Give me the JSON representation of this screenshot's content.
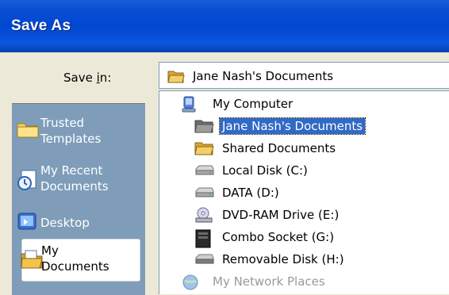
{
  "window": {
    "title": "Save As"
  },
  "save_in": {
    "label": "Save in:",
    "value": "Jane Nash's Documents"
  },
  "places_bar": {
    "items": [
      {
        "label_line1": "Trusted",
        "label_line2": "Templates",
        "icon": "folder-icon"
      },
      {
        "label_line1": "My Recent",
        "label_line2": "Documents",
        "icon": "recent-documents-icon"
      },
      {
        "label_line1": "Desktop",
        "icon": "desktop-icon"
      },
      {
        "label_line1": "My",
        "label_line2": "Documents",
        "icon": "my-documents-icon",
        "selected": true
      }
    ]
  },
  "dropdown_list": {
    "items": [
      {
        "label": "My Computer",
        "icon": "computer-icon"
      },
      {
        "label": "Jane Nash's Documents",
        "icon": "folder-open-icon",
        "selected": true
      },
      {
        "label": "Shared Documents",
        "icon": "folder-open-icon"
      },
      {
        "label": "Local Disk (C:)",
        "icon": "hard-drive-icon"
      },
      {
        "label": "DATA (D:)",
        "icon": "hard-drive-icon"
      },
      {
        "label": "DVD-RAM Drive (E:)",
        "icon": "dvd-drive-icon"
      },
      {
        "label": "Combo Socket (G:)",
        "icon": "media-socket-icon"
      },
      {
        "label": "Removable Disk (H:)",
        "icon": "removable-disk-icon"
      },
      {
        "label": "My Network Places",
        "icon": "network-places-icon"
      }
    ]
  }
}
